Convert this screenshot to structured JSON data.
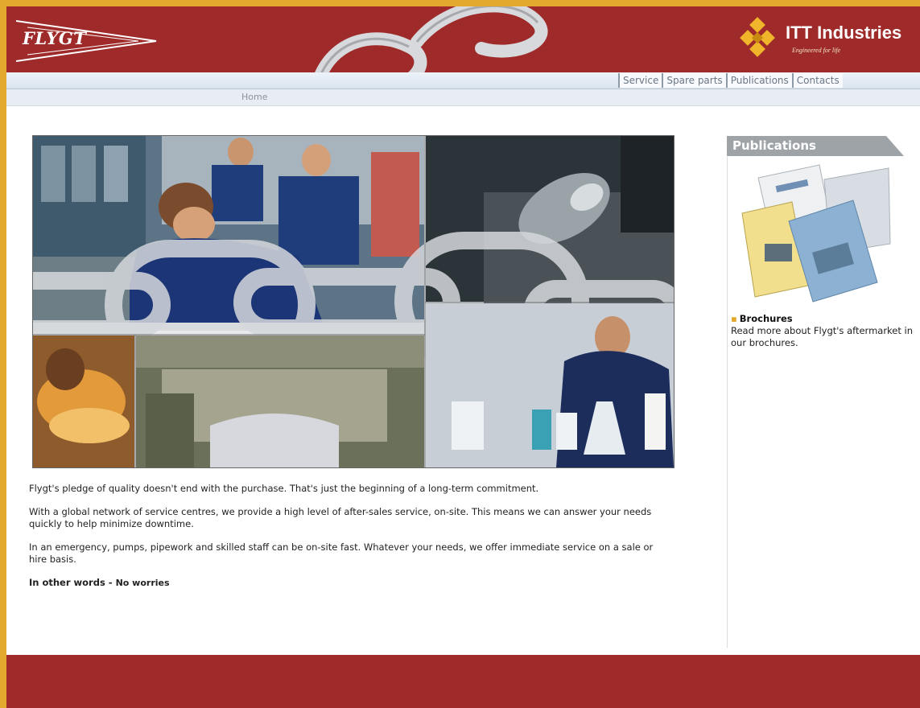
{
  "header": {
    "flygt_logo_text": "FLYGT",
    "itt_name": "ITT Industries",
    "itt_tagline": "Engineered for life"
  },
  "nav": {
    "left_text": "",
    "items": [
      {
        "label": "Service"
      },
      {
        "label": "Spare parts"
      },
      {
        "label": "Publications"
      },
      {
        "label": "Contacts"
      }
    ]
  },
  "breadcrumb": "Home",
  "content": {
    "paragraphs": [
      "Flygt's pledge of quality doesn't end with the purchase. That's just the beginning of a long-term commitment.",
      "With a global network of service centres, we provide a high level of after-sales service, on-site. This means we can answer your needs quickly to help minimize downtime.",
      "In an emergency, pumps, pipework and skilled staff can be on-site fast. Whatever your needs, we offer immediate service on a sale or hire basis."
    ],
    "slogan_a": "In other words - ",
    "slogan_b": "No worries"
  },
  "sidebar": {
    "header": "Publications",
    "brochures_title": "Brochures",
    "brochures_desc": "Read more about Flygt's aftermarket in our brochures."
  },
  "colors": {
    "brand_red": "#9e2a2a",
    "accent_gold": "#e3a92e",
    "nav_bg": "#e7edf3"
  }
}
